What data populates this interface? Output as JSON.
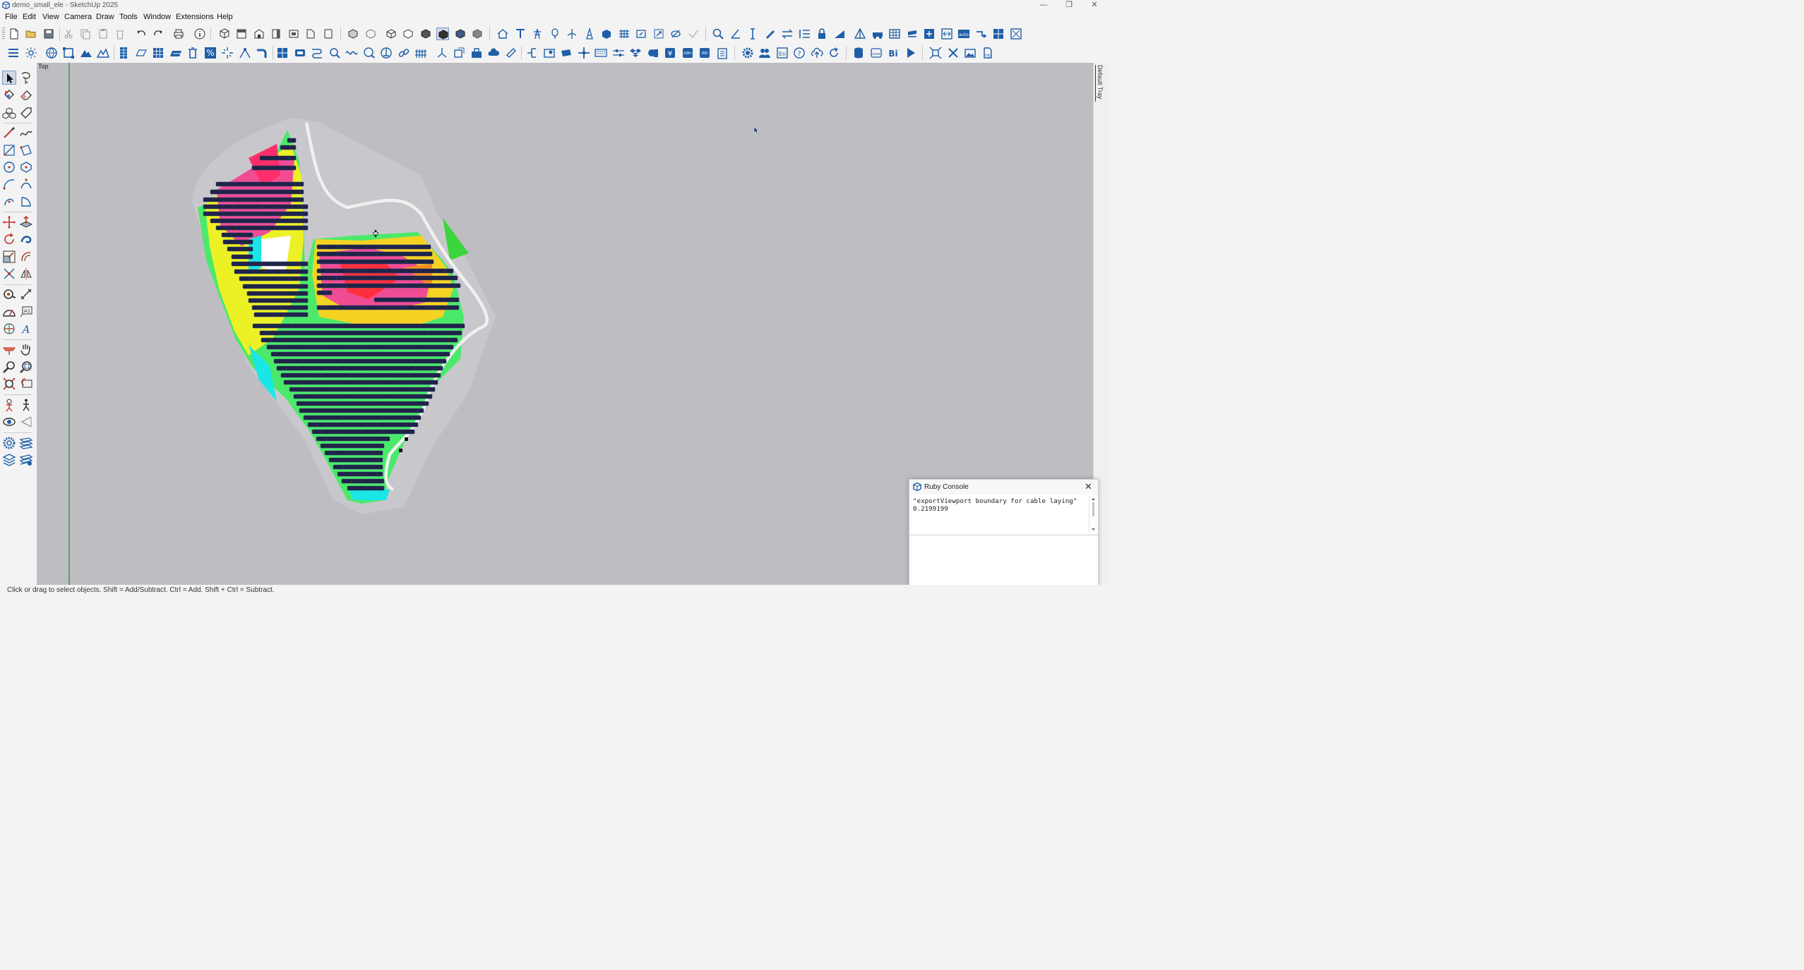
{
  "window": {
    "title": "demo_small_ele - SketchUp 2025",
    "controls": [
      "—",
      "❐",
      "✕"
    ]
  },
  "menu": [
    "File",
    "Edit",
    "View",
    "Camera",
    "Draw",
    "Tools",
    "Window",
    "Extensions",
    "Help"
  ],
  "viewport": {
    "view_name": "Top"
  },
  "tray": {
    "label": "Default Tray"
  },
  "ruby_console": {
    "title": "Ruby Console",
    "output": "\"exportViewport boundary for cable laying\"\n0.2199199"
  },
  "status": {
    "text": "Click or drag to select objects. Shift = Add/Subtract. Ctrl = Add. Shift + Ctrl = Subtract."
  },
  "colors": {
    "accent": "#1f5fa8",
    "viewport_bg": "#bdbdc2",
    "panel": "#1e2347"
  }
}
